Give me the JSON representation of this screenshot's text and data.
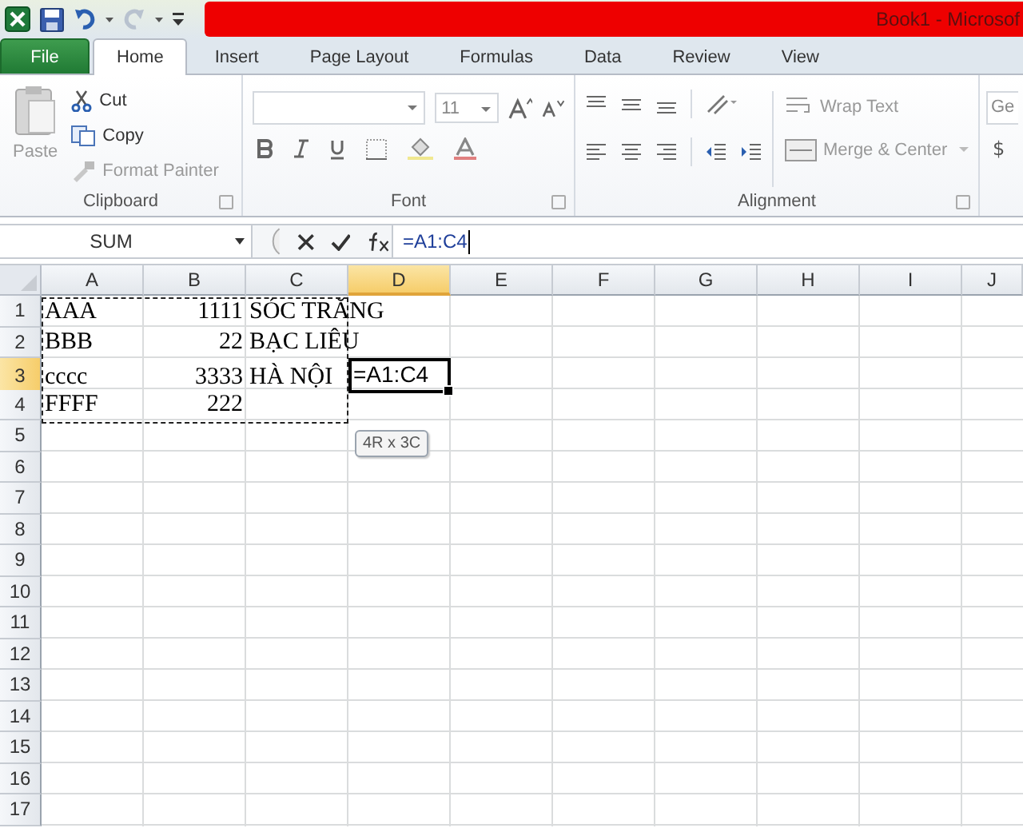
{
  "window": {
    "title": "Book1  -  Microsof"
  },
  "quick_access": [
    {
      "kind": "excel"
    },
    {
      "kind": "save"
    },
    {
      "kind": "undo"
    },
    {
      "kind": "dropdown"
    },
    {
      "kind": "redo"
    },
    {
      "kind": "dropdown"
    },
    {
      "kind": "customize"
    }
  ],
  "file_tab": "File",
  "tabs": [
    {
      "label": "Home",
      "selected": true
    },
    {
      "label": "Insert",
      "selected": false
    },
    {
      "label": "Page Layout",
      "selected": false
    },
    {
      "label": "Formulas",
      "selected": false
    },
    {
      "label": "Data",
      "selected": false
    },
    {
      "label": "Review",
      "selected": false
    },
    {
      "label": "View",
      "selected": false
    }
  ],
  "clipboard": {
    "title": "Clipboard",
    "paste": {
      "label": "Paste",
      "disabled": true
    },
    "items": [
      {
        "kind": "cut",
        "label": "Cut",
        "disabled": false
      },
      {
        "kind": "copy",
        "label": "Copy",
        "disabled": false
      },
      {
        "kind": "painter",
        "label": "Format Painter",
        "disabled": true
      }
    ]
  },
  "font": {
    "title": "Font",
    "size": "11"
  },
  "alignment": {
    "title": "Alignment",
    "wrap": "Wrap Text",
    "merge": "Merge & Center"
  },
  "number": {
    "format": "Ge",
    "currency": "$"
  },
  "formula_bar": {
    "name_box": "SUM",
    "formula": "=A1:C4"
  },
  "columns": [
    {
      "label": "A",
      "selected": false
    },
    {
      "label": "B",
      "selected": false
    },
    {
      "label": "C",
      "selected": false
    },
    {
      "label": "D",
      "selected": true
    },
    {
      "label": "E",
      "selected": false
    },
    {
      "label": "F",
      "selected": false
    },
    {
      "label": "G",
      "selected": false
    },
    {
      "label": "H",
      "selected": false
    },
    {
      "label": "I",
      "selected": false
    },
    {
      "label": "J",
      "selected": false
    }
  ],
  "rows": [
    {
      "header": "1",
      "selected": false,
      "cells": [
        {
          "text": "AAA",
          "kind": "text",
          "selected": false
        },
        {
          "text": "1111",
          "kind": "number",
          "selected": false
        },
        {
          "text": "SÓC TRĂNG",
          "kind": "text",
          "selected": false
        }
      ]
    },
    {
      "header": "2",
      "selected": false,
      "cells": [
        {
          "text": "BBB",
          "kind": "text",
          "selected": false
        },
        {
          "text": "22",
          "kind": "number",
          "selected": false
        },
        {
          "text": "BẠC LIÊU",
          "kind": "text",
          "selected": false
        }
      ]
    },
    {
      "header": "3",
      "selected": true,
      "cells": [
        {
          "text": "cccc",
          "kind": "text",
          "selected": false
        },
        {
          "text": "3333",
          "kind": "number",
          "selected": false
        },
        {
          "text": "HÀ NỘI",
          "kind": "text",
          "selected": false
        },
        {
          "text": "=A1:C4",
          "kind": "text",
          "selected": true
        }
      ]
    },
    {
      "header": "4",
      "selected": false,
      "cells": [
        {
          "text": "FFFF",
          "kind": "text",
          "selected": false
        },
        {
          "text": "222",
          "kind": "number",
          "selected": false
        }
      ]
    },
    {
      "header": "5",
      "selected": false,
      "cells": []
    },
    {
      "header": "6",
      "selected": false,
      "cells": []
    },
    {
      "header": "7",
      "selected": false,
      "cells": []
    },
    {
      "header": "8",
      "selected": false,
      "cells": []
    },
    {
      "header": "9",
      "selected": false,
      "cells": []
    },
    {
      "header": "10",
      "selected": false,
      "cells": []
    },
    {
      "header": "11",
      "selected": false,
      "cells": []
    },
    {
      "header": "12",
      "selected": false,
      "cells": []
    },
    {
      "header": "13",
      "selected": false,
      "cells": []
    },
    {
      "header": "14",
      "selected": false,
      "cells": []
    },
    {
      "header": "15",
      "selected": false,
      "cells": []
    },
    {
      "header": "16",
      "selected": false,
      "cells": []
    },
    {
      "header": "17",
      "selected": false,
      "cells": []
    }
  ],
  "range_tooltip": "4R x 3C"
}
